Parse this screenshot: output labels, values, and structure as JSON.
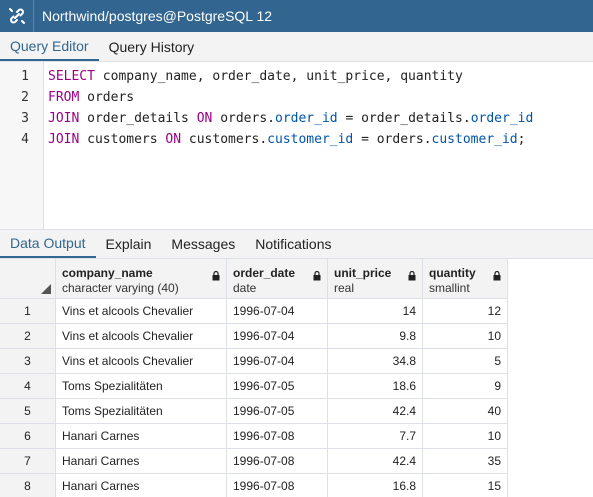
{
  "window": {
    "title": "Northwind/postgres@PostgreSQL 12"
  },
  "editor_tabs": [
    {
      "label": "Query Editor"
    },
    {
      "label": "Query History"
    }
  ],
  "editor": {
    "line_numbers": [
      "1",
      "2",
      "3",
      "4"
    ],
    "lines": [
      [
        {
          "t": "SELECT",
          "c": "kw"
        },
        {
          "t": " company_name, order_date, unit_price, quantity",
          "c": ""
        }
      ],
      [
        {
          "t": "FROM",
          "c": "kw"
        },
        {
          "t": " orders",
          "c": ""
        }
      ],
      [
        {
          "t": "JOIN",
          "c": "kw"
        },
        {
          "t": " order_details ",
          "c": ""
        },
        {
          "t": "ON",
          "c": "kw"
        },
        {
          "t": " orders.",
          "c": ""
        },
        {
          "t": "order_id",
          "c": "fld"
        },
        {
          "t": " = order_details.",
          "c": ""
        },
        {
          "t": "order_id",
          "c": "fld"
        }
      ],
      [
        {
          "t": "JOIN",
          "c": "kw"
        },
        {
          "t": " customers ",
          "c": ""
        },
        {
          "t": "ON",
          "c": "kw"
        },
        {
          "t": " customers.",
          "c": ""
        },
        {
          "t": "customer_id",
          "c": "fld"
        },
        {
          "t": " = orders.",
          "c": ""
        },
        {
          "t": "customer_id",
          "c": "fld"
        },
        {
          "t": ";",
          "c": ""
        }
      ]
    ]
  },
  "results_tabs": [
    {
      "label": "Data Output"
    },
    {
      "label": "Explain"
    },
    {
      "label": "Messages"
    },
    {
      "label": "Notifications"
    }
  ],
  "grid": {
    "columns": [
      {
        "name": "company_name",
        "type": "character varying (40)"
      },
      {
        "name": "order_date",
        "type": "date"
      },
      {
        "name": "unit_price",
        "type": "real"
      },
      {
        "name": "quantity",
        "type": "smallint"
      }
    ],
    "rows": [
      {
        "n": "1",
        "company_name": "Vins et alcools Chevalier",
        "order_date": "1996-07-04",
        "unit_price": "14",
        "quantity": "12"
      },
      {
        "n": "2",
        "company_name": "Vins et alcools Chevalier",
        "order_date": "1996-07-04",
        "unit_price": "9.8",
        "quantity": "10"
      },
      {
        "n": "3",
        "company_name": "Vins et alcools Chevalier",
        "order_date": "1996-07-04",
        "unit_price": "34.8",
        "quantity": "5"
      },
      {
        "n": "4",
        "company_name": "Toms Spezialitäten",
        "order_date": "1996-07-05",
        "unit_price": "18.6",
        "quantity": "9"
      },
      {
        "n": "5",
        "company_name": "Toms Spezialitäten",
        "order_date": "1996-07-05",
        "unit_price": "42.4",
        "quantity": "40"
      },
      {
        "n": "6",
        "company_name": "Hanari Carnes",
        "order_date": "1996-07-08",
        "unit_price": "7.7",
        "quantity": "10"
      },
      {
        "n": "7",
        "company_name": "Hanari Carnes",
        "order_date": "1996-07-08",
        "unit_price": "42.4",
        "quantity": "35"
      },
      {
        "n": "8",
        "company_name": "Hanari Carnes",
        "order_date": "1996-07-08",
        "unit_price": "16.8",
        "quantity": "15"
      }
    ]
  },
  "colors": {
    "titlebar": "#326690",
    "keyword": "#990088",
    "field": "#0055aa",
    "active_tab": "#326690"
  },
  "icons": {
    "connection": "connection-icon",
    "lock": "lock-icon",
    "sort": "sort-triangle-icon"
  }
}
